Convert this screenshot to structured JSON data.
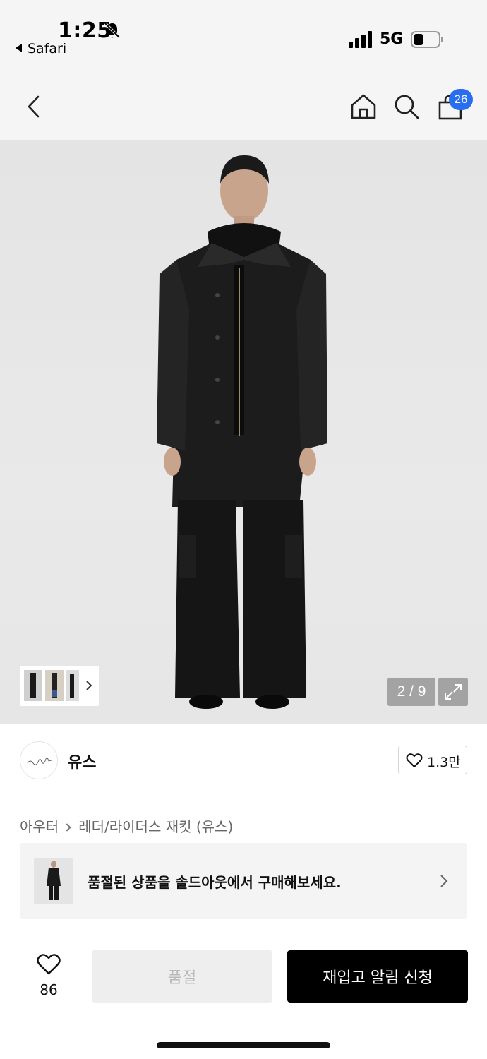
{
  "status_bar": {
    "time": "1:25",
    "back_app": "Safari",
    "network": "5G"
  },
  "nav": {
    "cart_count": "26",
    "icons": [
      "back-icon",
      "home-icon",
      "search-icon",
      "shopping-bag-icon"
    ]
  },
  "gallery": {
    "counter": "2 / 9"
  },
  "brand": {
    "name": "유스",
    "likes": "1.3만"
  },
  "breadcrumb": {
    "category": "아우터",
    "subcategory": "레더/라이더스 재킷 (유스)"
  },
  "soldout_banner": {
    "text": "품절된 상품을 솔드아웃에서 구매해보세요."
  },
  "bottom_bar": {
    "wish_count": "86",
    "soldout_label": "품절",
    "restock_label": "재입고 알림 신청"
  },
  "colors": {
    "badge": "#2a6ef0",
    "primary_button": "#000000",
    "disabled_button": "#eeeeee"
  }
}
